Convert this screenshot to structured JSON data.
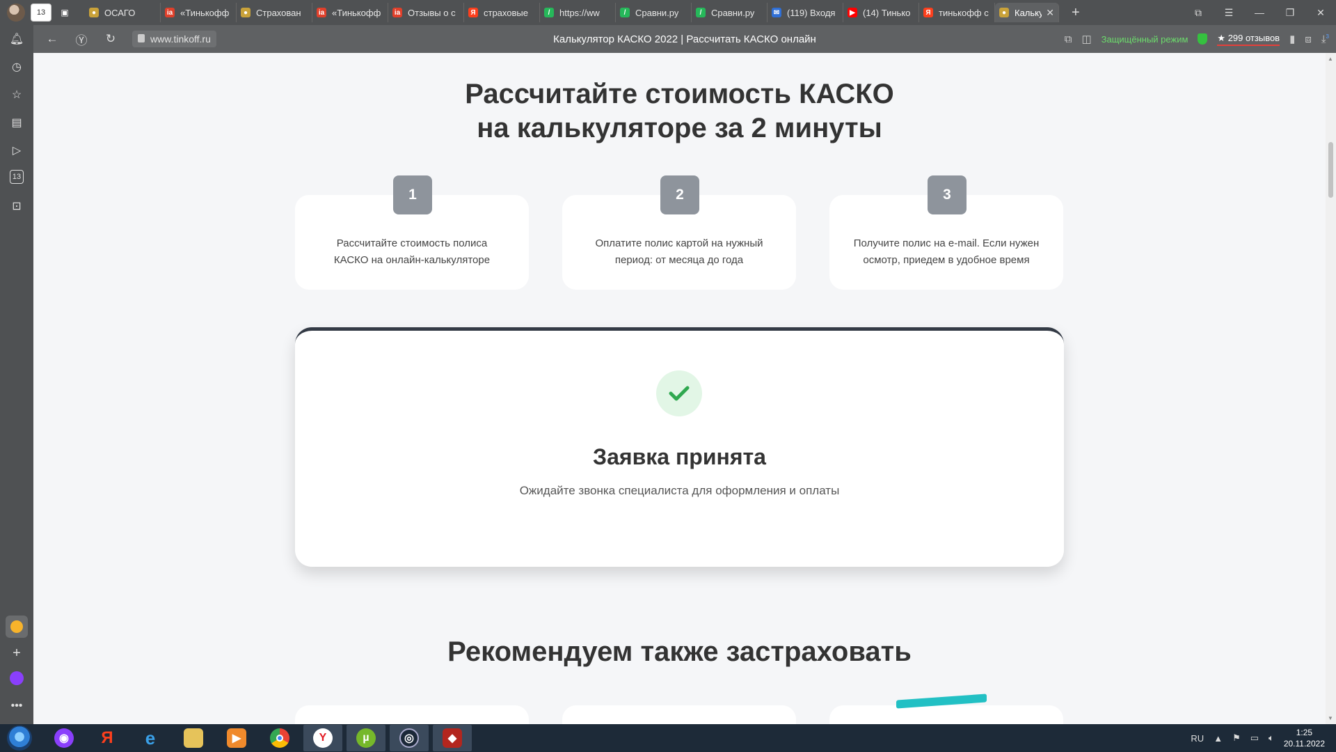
{
  "browser": {
    "tabs": [
      {
        "label": "ОСАГО",
        "icon": "shield-favicon",
        "color": "#c9a23a"
      },
      {
        "label": "«Тинькофф",
        "icon": "ia-favicon",
        "color": "#e0402b"
      },
      {
        "label": "Страхован",
        "icon": "shield-favicon",
        "color": "#c9a23a"
      },
      {
        "label": "«Тинькофф",
        "icon": "ia-favicon",
        "color": "#e0402b"
      },
      {
        "label": "Отзывы о с",
        "icon": "ia-favicon",
        "color": "#e0402b"
      },
      {
        "label": "страховые",
        "icon": "yandex-favicon",
        "color": "#fc3f1d"
      },
      {
        "label": "https://ww",
        "icon": "sravni-favicon",
        "color": "#26b85a"
      },
      {
        "label": "Сравни.ру",
        "icon": "sravni-favicon",
        "color": "#26b85a"
      },
      {
        "label": "Сравни.ру",
        "icon": "sravni-favicon",
        "color": "#26b85a"
      },
      {
        "label": "(119) Входя",
        "icon": "mail-favicon",
        "color": "#2f6fd6"
      },
      {
        "label": "(14) Тинько",
        "icon": "youtube-favicon",
        "color": "#ff0000"
      },
      {
        "label": "тинькофф с",
        "icon": "yandex-favicon",
        "color": "#fc3f1d"
      }
    ],
    "active_tab": {
      "label": "Калькул",
      "icon": "shield-favicon",
      "color": "#c9a23a"
    },
    "home_badge": "13",
    "url": "www.tinkoff.ru",
    "page_title": "Калькулятор КАСКО 2022 | Рассчитать КАСКО онлайн",
    "protect_mode": "Защищённый режим",
    "reviews": "299 отзывов",
    "downloads_badge": "3"
  },
  "sidebar": {
    "calendar_badge": "13"
  },
  "page": {
    "heading_line1": "Рассчитайте стоимость КАСКО",
    "heading_line2": "на калькуляторе за 2 минуты",
    "steps": [
      {
        "num": "1",
        "line1": "Рассчитайте стоимость полиса",
        "line2": "КАСКО на онлайн-калькуляторе"
      },
      {
        "num": "2",
        "line1": "Оплатите полис картой на нужный",
        "line2": "период: от месяца до года"
      },
      {
        "num": "3",
        "line1": "Получите полис на e-mail. Если нужен",
        "line2": "осмотр, приедем в удобное время"
      }
    ],
    "success_title": "Заявка принята",
    "success_sub": "Ожидайте звонка специалиста для оформления и оплаты",
    "recommend_heading": "Рекомендуем также застраховать"
  },
  "taskbar": {
    "lang": "RU",
    "time": "1:25",
    "date": "20.11.2022"
  }
}
